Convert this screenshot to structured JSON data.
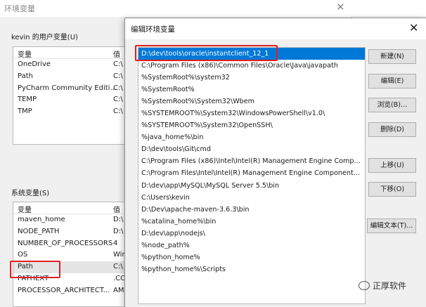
{
  "background_window": {
    "title": "环境变量",
    "user_vars_label": "kevin 的用户变量(U)",
    "user_vars": {
      "col_variable": "变量",
      "col_value": "值",
      "rows": [
        {
          "name": "OneDrive",
          "value": "C:\\"
        },
        {
          "name": "Path",
          "value": "C:\\"
        },
        {
          "name": "PyCharm Community Editi...",
          "value": "C:\\"
        },
        {
          "name": "TEMP",
          "value": "C:\\"
        },
        {
          "name": "TMP",
          "value": "C:\\"
        }
      ]
    },
    "system_vars_label": "系统变量(S)",
    "system_vars": {
      "col_variable": "变量",
      "col_value": "值",
      "rows": [
        {
          "name": "maven_home",
          "value": "D:\\"
        },
        {
          "name": "NODE_PATH",
          "value": "D:\\"
        },
        {
          "name": "NUMBER_OF_PROCESSORS",
          "value": "4"
        },
        {
          "name": "OS",
          "value": "Win"
        },
        {
          "name": "Path",
          "value": "C:\\"
        },
        {
          "name": "PATHEXT",
          "value": ".CO"
        },
        {
          "name": "PROCESSOR_ARCHITECT...",
          "value": "AM"
        }
      ]
    }
  },
  "dialog": {
    "title": "编辑环境变量",
    "paths": [
      "D:\\dev\\tools\\oracle\\instantclient_12_1",
      "C:\\Program Files (x86)\\Common Files\\Oracle\\Java\\javapath",
      "%SystemRoot%\\system32",
      "%SystemRoot%",
      "%SystemRoot%\\System32\\Wbem",
      "%SYSTEMROOT%\\System32\\WindowsPowerShell\\v1.0\\",
      "%SYSTEMROOT%\\System32\\OpenSSH\\",
      "%java_home%\\bin",
      "D:\\dev\\tools\\Git\\cmd",
      "C:\\Program Files (x86)\\Intel\\Intel(R) Management Engine Comp...",
      "C:\\Program Files\\Intel\\Intel(R) Management Engine Component...",
      "D:\\dev\\app\\MySQL\\MySQL Server 5.5\\bin",
      "C:\\Users\\kevin",
      "D:\\Dev\\apache-maven-3.6.3\\bin",
      "%catalina_home%\\bin",
      "D:\\dev\\app\\nodejs\\",
      "%node_path%",
      "%python_home%",
      "%python_home%\\Scripts"
    ],
    "buttons": {
      "new": "新建(N)",
      "edit": "编辑(E)",
      "browse": "浏览(B)...",
      "delete": "删除(D)",
      "move_up": "上移(U)",
      "move_down": "下移(O)",
      "edit_text": "编辑文本(T)..."
    }
  },
  "watermark": {
    "text": "正厚软件"
  },
  "colors": {
    "selection": "#0078d7",
    "highlight": "#e02020"
  }
}
